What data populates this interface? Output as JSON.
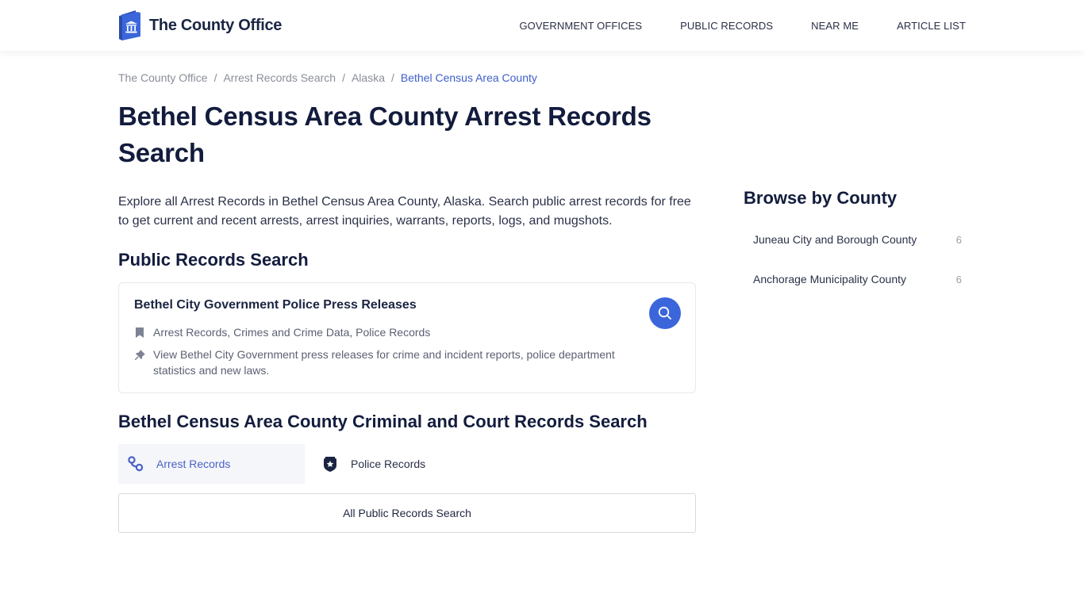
{
  "header": {
    "logo_text": "The County Office",
    "nav": [
      {
        "label": "GOVERNMENT OFFICES"
      },
      {
        "label": "PUBLIC RECORDS"
      },
      {
        "label": "NEAR ME"
      },
      {
        "label": "ARTICLE LIST"
      }
    ]
  },
  "breadcrumb": {
    "items": [
      {
        "label": "The County Office"
      },
      {
        "label": "Arrest Records Search"
      },
      {
        "label": "Alaska"
      }
    ],
    "current": "Bethel Census Area County",
    "separator": "/"
  },
  "page": {
    "title": "Bethel Census Area County Arrest Records Search",
    "intro": "Explore all Arrest Records in Bethel Census Area County, Alaska. Search public arrest records for free to get current and recent arrests, arrest inquiries, warrants, reports, logs, and mugshots."
  },
  "public_records": {
    "section_title": "Public Records Search",
    "card": {
      "title": "Bethel City Government Police Press Releases",
      "categories": "Arrest Records, Crimes and Crime Data, Police Records",
      "description": "View Bethel City Government press releases for crime and incident reports, police department statistics and new laws.",
      "category_icon": "bookmark-icon",
      "description_icon": "pin-icon",
      "action_icon": "search-icon"
    }
  },
  "criminal_court": {
    "section_title": "Bethel Census Area County Criminal and Court Records Search",
    "tabs": [
      {
        "label": "Arrest Records",
        "icon": "handcuffs-icon",
        "active": true
      },
      {
        "label": "Police Records",
        "icon": "police-badge-icon",
        "active": false
      }
    ],
    "all_button": "All Public Records Search"
  },
  "sidebar": {
    "title": "Browse by County",
    "counties": [
      {
        "name": "Juneau City and Borough County",
        "count": "6"
      },
      {
        "name": "Anchorage Municipality County",
        "count": "6"
      }
    ]
  },
  "colors": {
    "brand": "#3b66db",
    "heading": "#131c3d",
    "active_tab_text": "#4a62c6",
    "breadcrumb_current": "#3d5fc9"
  }
}
